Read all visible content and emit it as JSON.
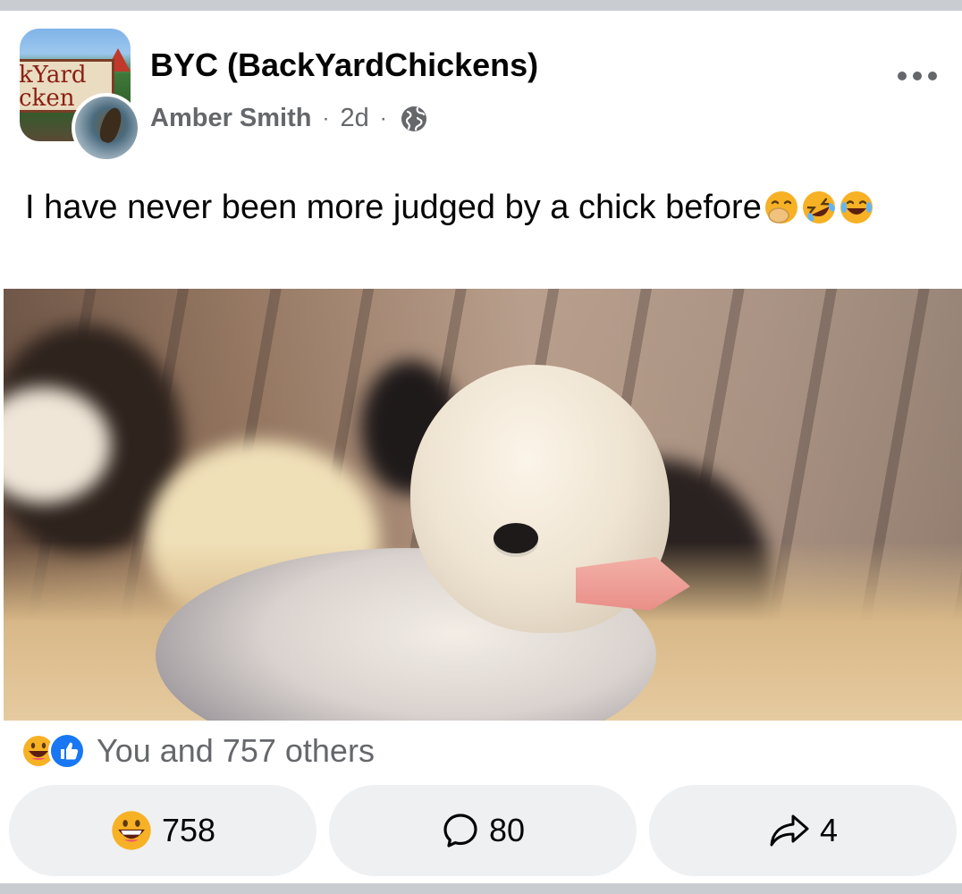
{
  "post": {
    "group_name": "BYC (BackYardChickens)",
    "author": "Amber Smith",
    "separator": "·",
    "time": "2d",
    "audience_icon": "globe-icon",
    "more_icon": "more-horizontal-icon",
    "group_avatar_text_line1": "kYard",
    "group_avatar_text_line2": "cken",
    "text": "I have never been more judged by a chick before",
    "text_emojis": [
      "face-with-open-eyes-and-hand-over-mouth",
      "rolling-on-the-floor-laughing",
      "face-with-tears-of-joy"
    ],
    "photo_alt": "Close-up of a fluffy white chick"
  },
  "reactions": {
    "icons": [
      "grinning-face-icon",
      "like-icon"
    ],
    "summary": "You and 757 others"
  },
  "actions": {
    "react": {
      "icon": "grinning-face-icon",
      "count": "758"
    },
    "comment": {
      "icon": "comment-icon",
      "count": "80"
    },
    "share": {
      "icon": "share-icon",
      "count": "4"
    }
  },
  "colors": {
    "background": "#c9ccd1",
    "card": "#ffffff",
    "secondary_text": "#65676b",
    "button_bg": "#eff0f2",
    "like_blue": "#1877f2",
    "emoji_yellow": "#f7b125"
  }
}
